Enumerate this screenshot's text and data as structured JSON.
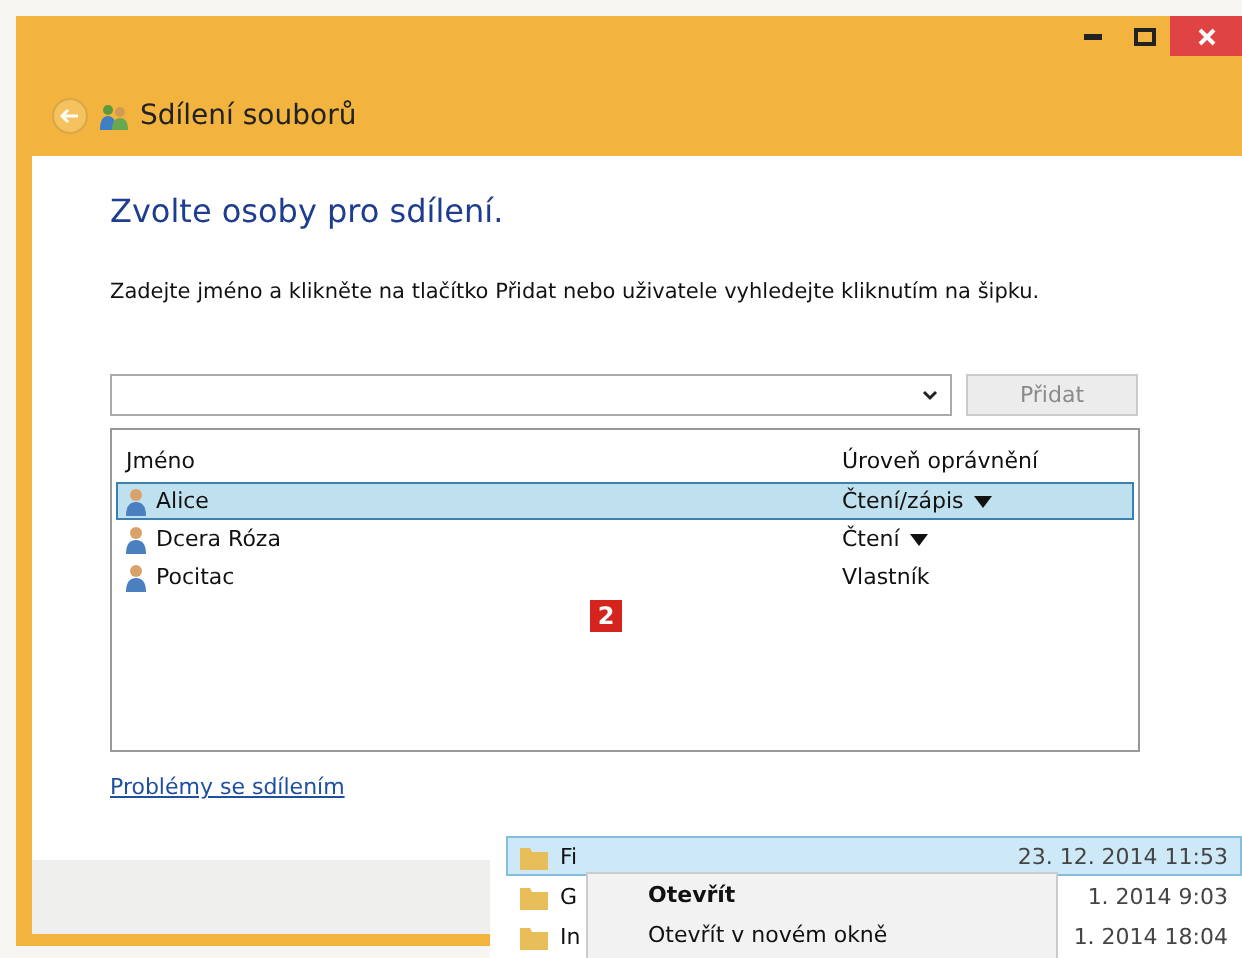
{
  "window": {
    "title": "Sdílení souborů"
  },
  "heading": "Zvolte osoby pro sdílení.",
  "instruction": "Zadejte jméno a klikněte na tlačítko Přidat nebo uživatele vyhledejte kliknutím na šipku.",
  "add_button": {
    "label": "Přidat",
    "disabled": true
  },
  "table": {
    "columns": [
      "Jméno",
      "Úroveň oprávnění"
    ],
    "rows": [
      {
        "name": "Alice",
        "permission": "Čtení/zápis",
        "has_menu": true,
        "selected": true
      },
      {
        "name": "Dcera Róza",
        "permission": "Čtení",
        "has_menu": true,
        "selected": false
      },
      {
        "name": "Pocitac",
        "permission": "Vlastník",
        "has_menu": false,
        "selected": false
      }
    ]
  },
  "badge": "2",
  "link": "Problémy se sdílením",
  "explorer": {
    "rows": [
      {
        "name": "Fi",
        "date": "23. 12. 2014 11:53",
        "selected": true
      },
      {
        "name": "G",
        "date": "1. 2014 9:03",
        "selected": false
      },
      {
        "name": "In",
        "date": "1. 2014 18:04",
        "selected": false
      }
    ]
  },
  "context_menu": {
    "items": [
      {
        "label": "Otevřít",
        "default": true
      },
      {
        "label": "Otevřít v novém okně",
        "default": false
      }
    ]
  }
}
